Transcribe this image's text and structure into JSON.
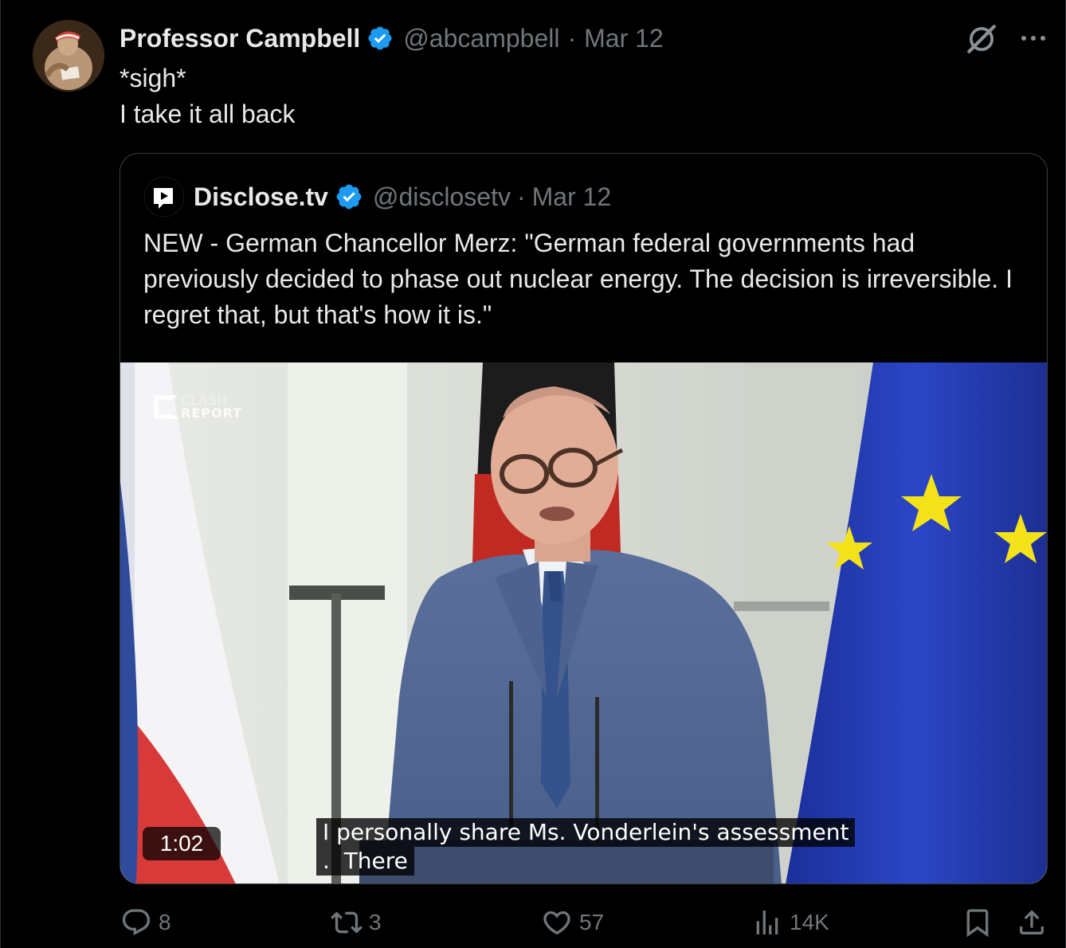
{
  "tweet": {
    "author_name": "Professor Campbell",
    "handle": "@abcampbell",
    "separator": "·",
    "date": "Mar 12",
    "text_lines": [
      "*sigh*",
      "I take it all back"
    ]
  },
  "quoted_tweet": {
    "author_name": "Disclose.tv",
    "handle": "@disclosetv",
    "separator": "·",
    "date": "Mar 12",
    "text": "NEW - German Chancellor Merz: \"German federal governments had previously decided to phase out nuclear energy. The decision is irreversible. I regret that, but that's how it is.\""
  },
  "video": {
    "duration": "1:02",
    "captions": [
      "I personally share Ms. Vonderlein's assessment",
      ".  There"
    ],
    "watermark": {
      "line1": "CLASH",
      "line2": "REPORT"
    }
  },
  "actions": {
    "replies": "8",
    "reposts": "3",
    "likes": "57",
    "views": "14K"
  },
  "colors": {
    "background": "#000000",
    "text_primary": "#e7e9ea",
    "text_secondary": "#71767b",
    "verified": "#1d9bf0",
    "border": "#2f3336"
  },
  "icons": [
    "verified-badge-icon",
    "grok-icon",
    "more-icon",
    "reply-icon",
    "repost-icon",
    "like-icon",
    "views-icon",
    "bookmark-icon",
    "share-icon"
  ]
}
